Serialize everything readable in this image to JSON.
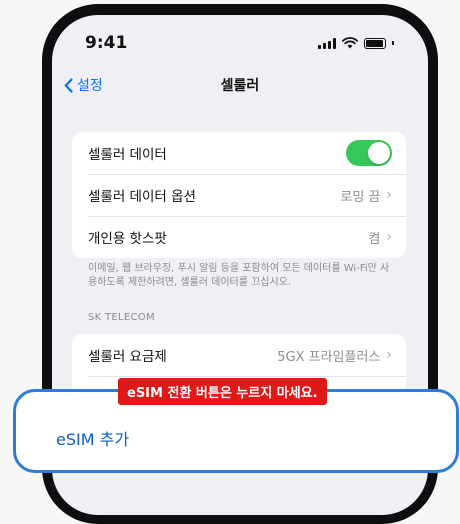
{
  "status": {
    "time": "9:41"
  },
  "nav": {
    "back_label": "설정",
    "title": "셀룰러"
  },
  "settings": {
    "cellular_data": {
      "label": "셀룰러 데이터",
      "enabled": true
    },
    "cellular_data_options": {
      "label": "셀룰러 데이터 옵션",
      "value": "로밍 끔"
    },
    "personal_hotspot": {
      "label": "개인용 핫스팟",
      "value": "켬"
    },
    "footnote": "이메일, 웹 브라우징, 푸시 알림 등을 포함하여 모든 데이터를 Wi-Fi만 사용하도록 제한하려면, 셀룰러 데이터를 끄십시오.",
    "carrier_header": "SK TELECOM",
    "plan": {
      "label": "셀룰러 요금제",
      "value": "5GX 프라임플러스"
    }
  },
  "warning_text": "eSIM 전환 버튼은 누르지 마세요.",
  "esim_button_label": "eSIM 추가",
  "colors": {
    "accent": "#0a72ff",
    "toggle_on": "#34c759",
    "warning": "#e01818",
    "callout_border": "#2a7ed8"
  }
}
